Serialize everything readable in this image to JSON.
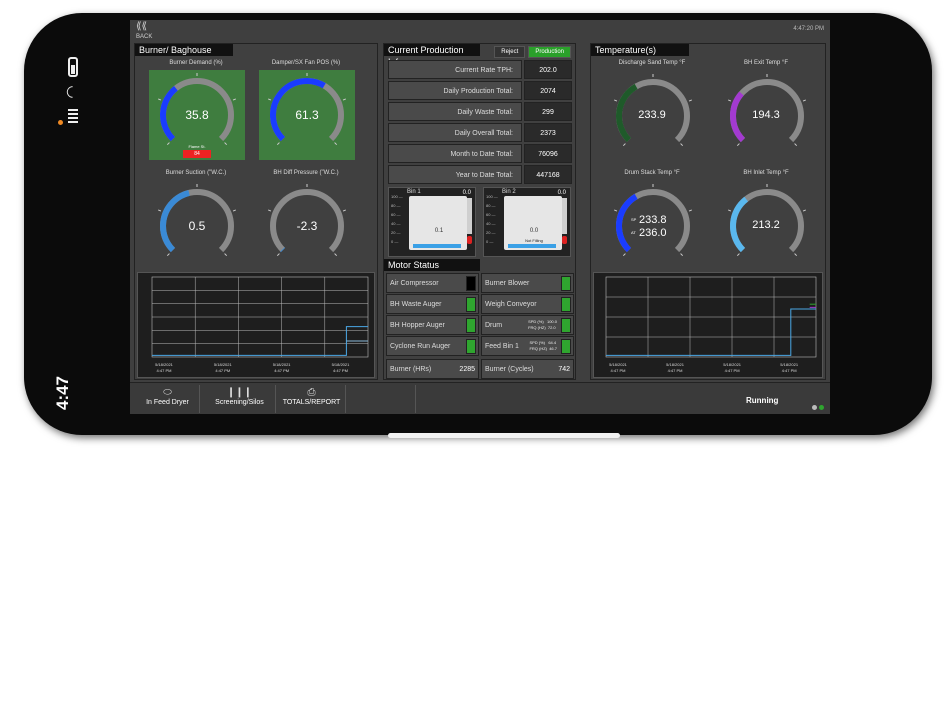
{
  "status_bar": {
    "time": "4:47"
  },
  "header": {
    "back_label": "BACK",
    "clock": "4:47:20 PM"
  },
  "burner": {
    "title": "Burner/ Baghouse",
    "gauges": [
      {
        "label": "Burner Demand (%)",
        "value": "35.8",
        "level": 0.358,
        "color": "#1a3cff",
        "sub": "Flame St.",
        "tag": "84"
      },
      {
        "label": "Damper/SX Fan POS (%)",
        "value": "61.3",
        "level": 0.613,
        "color": "#1a3cff"
      },
      {
        "label": "Burner Suction (\"W.C.)",
        "value": "0.5",
        "level": 0.45,
        "color": "#3a8ad6"
      },
      {
        "label": "BH Diff Pressure (\"W.C.)",
        "value": "-2.3",
        "level": 0.0,
        "color": "#3a8ad6"
      }
    ],
    "chart_times": [
      "5/18/2021\n4:47 PM",
      "5/18/2021\n4:47 PM",
      "5/18/2021\n4:47 PM",
      "5/18/2021\n4:47 PM"
    ]
  },
  "production": {
    "title": "Current Production Info",
    "reject_label": "Reject",
    "production_label": "Production",
    "rows": [
      {
        "label": "Current Rate TPH:",
        "value": "202.0"
      },
      {
        "label": "Daily Production Total:",
        "value": "2074"
      },
      {
        "label": "Daily Waste Total:",
        "value": "299"
      },
      {
        "label": "Daily Overall Total:",
        "value": "2373"
      },
      {
        "label": "Month to Date Total:",
        "value": "76096"
      },
      {
        "label": "Year to Date Total:",
        "value": "447168"
      }
    ],
    "bins": [
      {
        "name": "Bin 1",
        "top": "0.0",
        "value": "0.1",
        "tag": ""
      },
      {
        "name": "Bin 2",
        "top": "0.0",
        "value": "0.0",
        "tag": "Not Filling"
      }
    ],
    "bin_axis": [
      "100 —",
      "80 —",
      "60 —",
      "40 —",
      "20 —",
      "0 —"
    ]
  },
  "motors": {
    "title": "Motor Status",
    "items": [
      {
        "label": "Air Compressor",
        "state": "off"
      },
      {
        "label": "Burner Blower",
        "state": "on"
      },
      {
        "label": "BH Waste Auger",
        "state": "on"
      },
      {
        "label": "Weigh Conveyor",
        "state": "on"
      },
      {
        "label": "BH Hopper Auger",
        "state": "on"
      },
      {
        "label": "Drum",
        "state": "on",
        "mini": "SPD (%)   100.0\nFRQ (HZ)  72.0"
      },
      {
        "label": "Cyclone Run Auger",
        "state": "on"
      },
      {
        "label": "Feed Bin 1",
        "state": "on",
        "mini": "SPD (%)   64.4\nFRQ (HZ)  46.7"
      }
    ],
    "burner_hrs_label": "Burner (HRs)",
    "burner_hrs": "2285",
    "burner_cycles_label": "Burner (Cycles)",
    "burner_cycles": "742"
  },
  "temperature": {
    "title": "Temperature(s)",
    "gauges": [
      {
        "label": "Discharge Sand Temp °F",
        "value": "233.9",
        "level": 0.39,
        "color": "#1f5a2a"
      },
      {
        "label": "BH Exit Temp °F",
        "value": "194.3",
        "level": 0.32,
        "color": "#a33ad0"
      },
      {
        "label": "Drum Stack Temp °F",
        "value_a": "233.8",
        "value_b": "236.0",
        "tag_a": "SP",
        "tag_b": "AT",
        "level": 0.39,
        "color": "#1a3cff"
      },
      {
        "label": "BH Inlet Temp °F",
        "value": "213.2",
        "level": 0.36,
        "color": "#5ab8ee"
      }
    ]
  },
  "nav": {
    "items": [
      {
        "label": "In Feed Dryer"
      },
      {
        "label": "Screening/Silos"
      },
      {
        "label": "TOTALS/REPORT"
      }
    ],
    "status": "Running"
  },
  "colors": {
    "green": "#2fa52f",
    "panel": "#404040",
    "gauge_track": "#8a8a8a"
  }
}
